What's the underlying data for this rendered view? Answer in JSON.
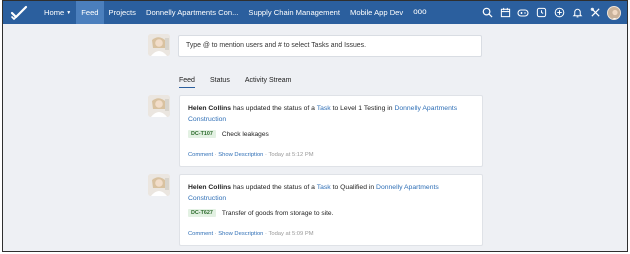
{
  "nav": {
    "home": "Home",
    "feed": "Feed",
    "projects": "Projects",
    "project1": "Donnelly Apartments Con...",
    "project2": "Supply Chain Management",
    "project3": "Mobile App Dev",
    "more": "ooo"
  },
  "toolbar_icons": [
    "search-icon",
    "calendar-icon",
    "gamepad-icon",
    "timer-icon",
    "plus-icon",
    "bell-icon",
    "tools-icon",
    "avatar"
  ],
  "colors": {
    "topbar": "#2b5f9e",
    "active_tab": "#4b7fbd",
    "link": "#2f6fb6",
    "task_badge_bg": "#e3f1e3"
  },
  "composer": {
    "placeholder": "Type @ to mention users and # to select Tasks and Issues."
  },
  "tabs": [
    "Feed",
    "Status",
    "Activity Stream"
  ],
  "posts": [
    {
      "user": "Helen Collins",
      "text1": " has updated the status of a ",
      "task_link": "Task",
      "text2": " to Level 1 Testing in ",
      "project": "Donnelly Apartments Construction",
      "task_id": "DC-T107",
      "task_name": "Check leakages",
      "comment": "Comment",
      "sep1": " · ",
      "show_description": "Show Description",
      "sep2": " · ",
      "time": "Today at 5:12 PM"
    },
    {
      "user": "Helen Collins",
      "text1": " has updated the status of a ",
      "task_link": "Task",
      "text2": " to Qualified in ",
      "project": "Donnelly Apartments Construction",
      "task_id": "DC-T627",
      "task_name": "Transfer of goods from storage to site.",
      "comment": "Comment",
      "sep1": " · ",
      "show_description": "Show Description",
      "sep2": " · ",
      "time": "Today at 5:09 PM"
    }
  ]
}
